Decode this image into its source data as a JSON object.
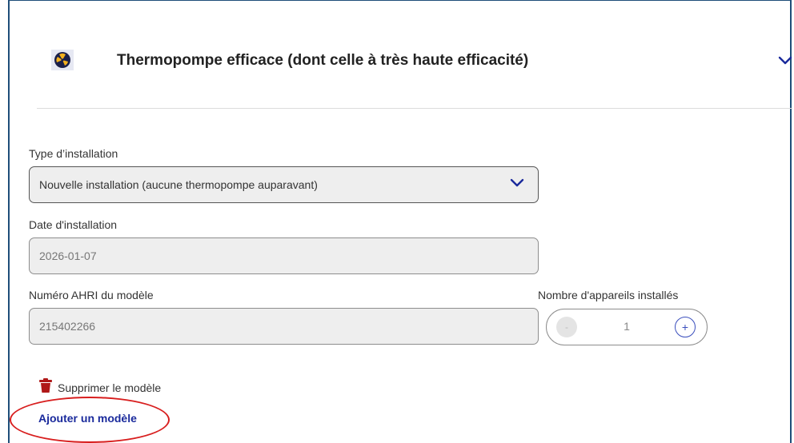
{
  "header": {
    "title": "Thermopompe efficace (dont celle à très haute efficacité)",
    "icon": "heat-pump-fan-icon",
    "expand_icon": "chevron-down-icon"
  },
  "form": {
    "installation_type": {
      "label": "Type d’installation",
      "value": "Nouvelle installation (aucune thermopompe auparavant)"
    },
    "installation_date": {
      "label": "Date d'installation",
      "value": "2026-01-07"
    },
    "ahri_number": {
      "label": "Numéro AHRI du modèle",
      "value": "215402266"
    },
    "device_count": {
      "label": "Nombre d'appareils installés",
      "value": "1",
      "minus": "-",
      "plus": "+"
    }
  },
  "actions": {
    "delete_model": "Supprimer le modèle",
    "add_model": "Ajouter un modèle"
  },
  "colors": {
    "accent": "#1a2a9c",
    "annotation": "#d81e1e",
    "trash": "#b01818"
  }
}
